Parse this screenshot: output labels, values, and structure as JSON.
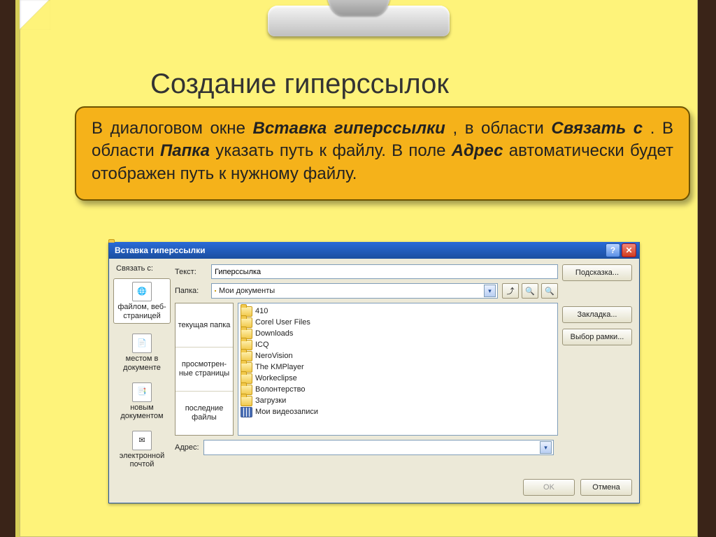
{
  "slide": {
    "heading": "Создание гиперссылок",
    "note_parts": {
      "p1": "В диалоговом окне ",
      "b1": "Вставка гиперссылки",
      "p2": ", в области ",
      "b2": "Связать с",
      "p3": ". В области ",
      "b3": "Папка",
      "p4": " указать путь к файлу. В поле ",
      "b4": "Адрес",
      "p5": " автоматически будет отображен путь к нужному файлу."
    }
  },
  "dialog": {
    "title": "Вставка гиперссылки",
    "help_glyph": "?",
    "close_glyph": "✕",
    "link_with_label": "Связать с:",
    "text_label": "Текст:",
    "text_value": "Гиперссылка",
    "hint_btn": "Подсказка...",
    "folder_label": "Папка:",
    "folder_value": "Мои документы",
    "up_glyph": "⤴",
    "back_glyph": "◀",
    "search_glyph": "🔍",
    "link_types": [
      {
        "label": "файлом, веб-страницей",
        "active": true
      },
      {
        "label": "местом в документе",
        "active": false
      },
      {
        "label": "новым документом",
        "active": false
      },
      {
        "label": "электронной почтой",
        "active": false
      }
    ],
    "tabs": [
      "текущая папка",
      "просмотрен-ные страницы",
      "последние файлы"
    ],
    "files": [
      {
        "name": "410",
        "type": "folder"
      },
      {
        "name": "Corel User Files",
        "type": "folder"
      },
      {
        "name": "Downloads",
        "type": "folder"
      },
      {
        "name": "ICQ",
        "type": "folder"
      },
      {
        "name": "NeroVision",
        "type": "folder"
      },
      {
        "name": "The KMPlayer",
        "type": "folder"
      },
      {
        "name": "Workeclipse",
        "type": "folder"
      },
      {
        "name": "Волонтерство",
        "type": "folder"
      },
      {
        "name": "Загрузки",
        "type": "folder"
      },
      {
        "name": "Мои видеозаписи",
        "type": "film"
      }
    ],
    "bookmark_btn": "Закладка...",
    "frame_btn": "Выбор рамки...",
    "address_label": "Адрес:",
    "address_value": "",
    "ok_btn": "OK",
    "cancel_btn": "Отмена",
    "dd_glyph": "▾"
  }
}
